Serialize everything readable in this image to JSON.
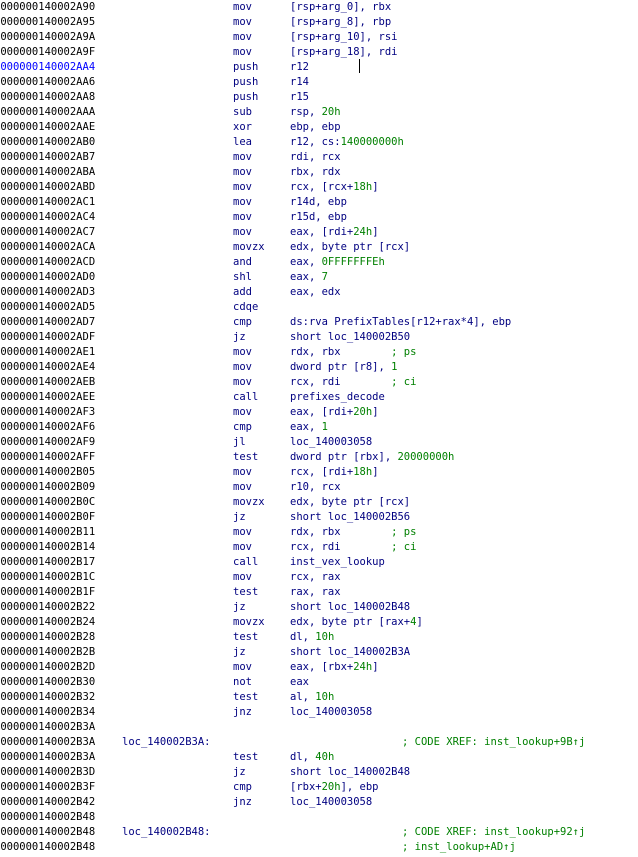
{
  "highlight_color": "#0000ff",
  "mnemonic_color": "#000080",
  "comment_color": "#008000",
  "lines": [
    {
      "addr": "0000000140002A90",
      "mnem": "mov",
      "ops": [
        [
          "[rsp+arg_0], rbx",
          ""
        ]
      ]
    },
    {
      "addr": "0000000140002A95",
      "mnem": "mov",
      "ops": [
        [
          "[rsp+arg_8], rbp",
          ""
        ]
      ]
    },
    {
      "addr": "0000000140002A9A",
      "mnem": "mov",
      "ops": [
        [
          "[rsp+arg_10], rsi",
          ""
        ]
      ]
    },
    {
      "addr": "0000000140002A9F",
      "mnem": "mov",
      "ops": [
        [
          "[rsp+arg_18], rdi",
          ""
        ]
      ]
    },
    {
      "addr": "0000000140002AA4",
      "mnem": "push",
      "ops": [
        [
          "r12",
          ""
        ]
      ],
      "hl": true
    },
    {
      "addr": "0000000140002AA6",
      "mnem": "push",
      "ops": [
        [
          "r14",
          ""
        ]
      ]
    },
    {
      "addr": "0000000140002AA8",
      "mnem": "push",
      "ops": [
        [
          "r15",
          ""
        ]
      ]
    },
    {
      "addr": "0000000140002AAA",
      "mnem": "sub",
      "ops": [
        [
          "rsp, ",
          ""
        ],
        [
          "20h",
          "num"
        ]
      ]
    },
    {
      "addr": "0000000140002AAE",
      "mnem": "xor",
      "ops": [
        [
          "ebp, ebp",
          ""
        ]
      ]
    },
    {
      "addr": "0000000140002AB0",
      "mnem": "lea",
      "ops": [
        [
          "r12, cs:",
          ""
        ],
        [
          "140000000h",
          "num"
        ]
      ]
    },
    {
      "addr": "0000000140002AB7",
      "mnem": "mov",
      "ops": [
        [
          "rdi, rcx",
          ""
        ]
      ]
    },
    {
      "addr": "0000000140002ABA",
      "mnem": "mov",
      "ops": [
        [
          "rbx, rdx",
          ""
        ]
      ]
    },
    {
      "addr": "0000000140002ABD",
      "mnem": "mov",
      "ops": [
        [
          "rcx, [rcx+",
          ""
        ],
        [
          "18h",
          "num"
        ],
        [
          "]",
          ""
        ]
      ]
    },
    {
      "addr": "0000000140002AC1",
      "mnem": "mov",
      "ops": [
        [
          "r14d, ebp",
          ""
        ]
      ]
    },
    {
      "addr": "0000000140002AC4",
      "mnem": "mov",
      "ops": [
        [
          "r15d, ebp",
          ""
        ]
      ]
    },
    {
      "addr": "0000000140002AC7",
      "mnem": "mov",
      "ops": [
        [
          "eax, [rdi+",
          ""
        ],
        [
          "24h",
          "num"
        ],
        [
          "]",
          ""
        ]
      ]
    },
    {
      "addr": "0000000140002ACA",
      "mnem": "movzx",
      "ops": [
        [
          "edx, byte ptr [rcx]",
          ""
        ]
      ]
    },
    {
      "addr": "0000000140002ACD",
      "mnem": "and",
      "ops": [
        [
          "eax, ",
          ""
        ],
        [
          "0FFFFFFFEh",
          "num"
        ]
      ]
    },
    {
      "addr": "0000000140002AD0",
      "mnem": "shl",
      "ops": [
        [
          "eax, ",
          ""
        ],
        [
          "7",
          "num"
        ]
      ]
    },
    {
      "addr": "0000000140002AD3",
      "mnem": "add",
      "ops": [
        [
          "eax, edx",
          ""
        ]
      ]
    },
    {
      "addr": "0000000140002AD5",
      "mnem": "cdqe",
      "ops": []
    },
    {
      "addr": "0000000140002AD7",
      "mnem": "cmp",
      "ops": [
        [
          "ds:rva PrefixTables[r12+rax*4], ebp",
          ""
        ]
      ]
    },
    {
      "addr": "0000000140002ADF",
      "mnem": "jz",
      "ops": [
        [
          "short loc_140002B50",
          ""
        ]
      ]
    },
    {
      "addr": "0000000140002AE1",
      "mnem": "mov",
      "ops": [
        [
          "rdx, rbx        ",
          ""
        ],
        [
          "; ps",
          "cmt"
        ]
      ]
    },
    {
      "addr": "0000000140002AE4",
      "mnem": "mov",
      "ops": [
        [
          "dword ptr [r8], ",
          ""
        ],
        [
          "1",
          "num"
        ]
      ]
    },
    {
      "addr": "0000000140002AEB",
      "mnem": "mov",
      "ops": [
        [
          "rcx, rdi        ",
          ""
        ],
        [
          "; ci",
          "cmt"
        ]
      ]
    },
    {
      "addr": "0000000140002AEE",
      "mnem": "call",
      "ops": [
        [
          "prefixes_decode",
          ""
        ]
      ]
    },
    {
      "addr": "0000000140002AF3",
      "mnem": "mov",
      "ops": [
        [
          "eax, [rdi+",
          ""
        ],
        [
          "20h",
          "num"
        ],
        [
          "]",
          ""
        ]
      ]
    },
    {
      "addr": "0000000140002AF6",
      "mnem": "cmp",
      "ops": [
        [
          "eax, ",
          ""
        ],
        [
          "1",
          "num"
        ]
      ]
    },
    {
      "addr": "0000000140002AF9",
      "mnem": "jl",
      "ops": [
        [
          "loc_140003058",
          ""
        ]
      ]
    },
    {
      "addr": "0000000140002AFF",
      "mnem": "test",
      "ops": [
        [
          "dword ptr [rbx], ",
          ""
        ],
        [
          "20000000h",
          "num"
        ]
      ]
    },
    {
      "addr": "0000000140002B05",
      "mnem": "mov",
      "ops": [
        [
          "rcx, [rdi+",
          ""
        ],
        [
          "18h",
          "num"
        ],
        [
          "]",
          ""
        ]
      ]
    },
    {
      "addr": "0000000140002B09",
      "mnem": "mov",
      "ops": [
        [
          "r10, rcx",
          ""
        ]
      ]
    },
    {
      "addr": "0000000140002B0C",
      "mnem": "movzx",
      "ops": [
        [
          "edx, byte ptr [rcx]",
          ""
        ]
      ]
    },
    {
      "addr": "0000000140002B0F",
      "mnem": "jz",
      "ops": [
        [
          "short loc_140002B56",
          ""
        ]
      ]
    },
    {
      "addr": "0000000140002B11",
      "mnem": "mov",
      "ops": [
        [
          "rdx, rbx        ",
          ""
        ],
        [
          "; ps",
          "cmt"
        ]
      ]
    },
    {
      "addr": "0000000140002B14",
      "mnem": "mov",
      "ops": [
        [
          "rcx, rdi        ",
          ""
        ],
        [
          "; ci",
          "cmt"
        ]
      ]
    },
    {
      "addr": "0000000140002B17",
      "mnem": "call",
      "ops": [
        [
          "inst_vex_lookup",
          ""
        ]
      ]
    },
    {
      "addr": "0000000140002B1C",
      "mnem": "mov",
      "ops": [
        [
          "rcx, rax",
          ""
        ]
      ]
    },
    {
      "addr": "0000000140002B1F",
      "mnem": "test",
      "ops": [
        [
          "rax, rax",
          ""
        ]
      ]
    },
    {
      "addr": "0000000140002B22",
      "mnem": "jz",
      "ops": [
        [
          "short loc_140002B48",
          ""
        ]
      ]
    },
    {
      "addr": "0000000140002B24",
      "mnem": "movzx",
      "ops": [
        [
          "edx, byte ptr [rax+",
          ""
        ],
        [
          "4",
          "num"
        ],
        [
          "]",
          ""
        ]
      ]
    },
    {
      "addr": "0000000140002B28",
      "mnem": "test",
      "ops": [
        [
          "dl, ",
          ""
        ],
        [
          "10h",
          "num"
        ]
      ]
    },
    {
      "addr": "0000000140002B2B",
      "mnem": "jz",
      "ops": [
        [
          "short loc_140002B3A",
          ""
        ]
      ]
    },
    {
      "addr": "0000000140002B2D",
      "mnem": "mov",
      "ops": [
        [
          "eax, [rbx+",
          ""
        ],
        [
          "24h",
          "num"
        ],
        [
          "]",
          ""
        ]
      ]
    },
    {
      "addr": "0000000140002B30",
      "mnem": "not",
      "ops": [
        [
          "eax",
          ""
        ]
      ]
    },
    {
      "addr": "0000000140002B32",
      "mnem": "test",
      "ops": [
        [
          "al, ",
          ""
        ],
        [
          "10h",
          "num"
        ]
      ]
    },
    {
      "addr": "0000000140002B34",
      "mnem": "jnz",
      "ops": [
        [
          "loc_140003058",
          ""
        ]
      ]
    },
    {
      "addr": "0000000140002B3A",
      "mnem": "",
      "ops": []
    },
    {
      "addr": "0000000140002B3A",
      "label": "loc_140002B3A:",
      "xref": "; CODE XREF: inst_lookup+9B↑j"
    },
    {
      "addr": "0000000140002B3A",
      "mnem": "test",
      "ops": [
        [
          "dl, ",
          ""
        ],
        [
          "40h",
          "num"
        ]
      ]
    },
    {
      "addr": "0000000140002B3D",
      "mnem": "jz",
      "ops": [
        [
          "short loc_140002B48",
          ""
        ]
      ]
    },
    {
      "addr": "0000000140002B3F",
      "mnem": "cmp",
      "ops": [
        [
          "[rbx+",
          ""
        ],
        [
          "20h",
          "num"
        ],
        [
          "], ebp",
          ""
        ]
      ]
    },
    {
      "addr": "0000000140002B42",
      "mnem": "jnz",
      "ops": [
        [
          "loc_140003058",
          ""
        ]
      ]
    },
    {
      "addr": "0000000140002B48",
      "mnem": "",
      "ops": []
    },
    {
      "addr": "0000000140002B48",
      "label": "loc_140002B48:",
      "xref": "; CODE XREF: inst_lookup+92↑j"
    },
    {
      "addr": "0000000140002B48",
      "xref": "; inst_lookup+AD↑j"
    }
  ]
}
